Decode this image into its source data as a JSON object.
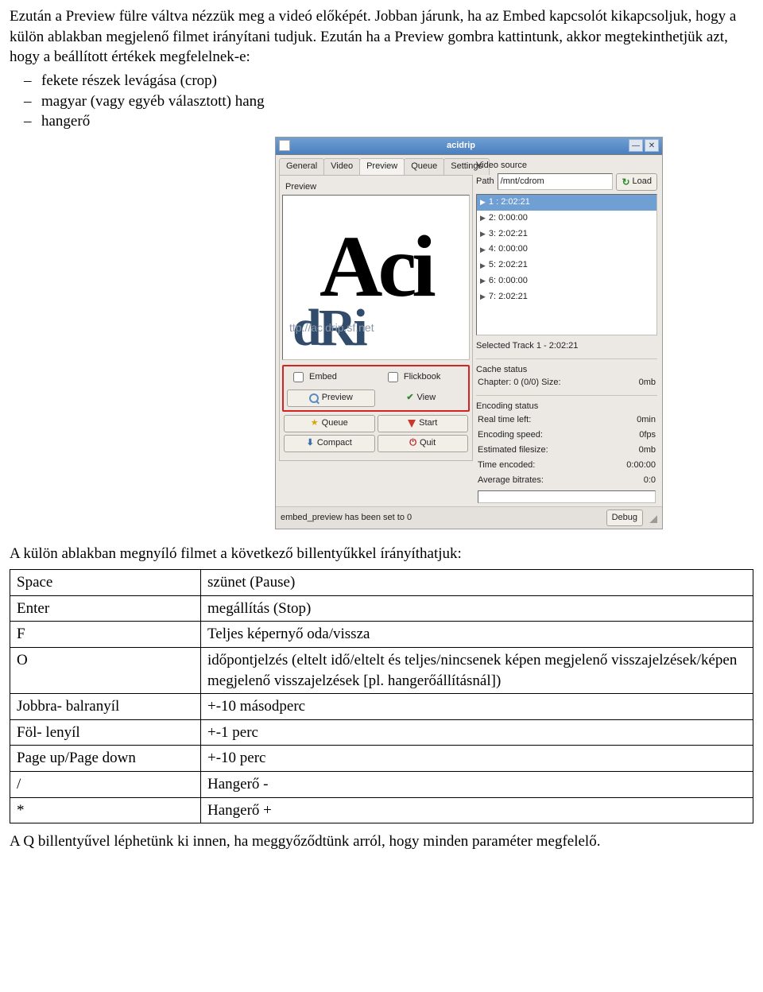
{
  "para1": "Ezután a Preview fülre váltva nézzük meg a videó előképét. Jobban járunk, ha az Embed kapcsolót kikapcsoljuk, hogy a külön ablakban megjelenő filmet irányítani tudjuk. Ezután ha a Preview gombra kattintunk, akkor megtekinthetjük azt, hogy a beállított értékek megfelelnek-e:",
  "bullets": {
    "b1": "fekete részek levágása (crop)",
    "b2": "magyar (vagy egyéb választott) hang",
    "b3": "hangerő"
  },
  "para2": "A külön ablakban megnyíló filmet a következő billentyűkkel írányíthatjuk:",
  "para3": "A Q billentyűvel léphetünk ki innen, ha meggyőződtünk arról, hogy minden paraméter megfelelő.",
  "keys": {
    "k1": "Space",
    "v1": "szünet (Pause)",
    "k2": "Enter",
    "v2": "megállítás (Stop)",
    "k3": "F",
    "v3": "Teljes képernyő oda/vissza",
    "k4": "O",
    "v4": "időpontjelzés (eltelt idő/eltelt és teljes/nincsenek képen megjelenő visszajelzések/képen megjelenő visszajelzések [pl. hangerőállításnál])",
    "k5": "Jobbra- balranyíl",
    "v5": "+-10 másodperc",
    "k6": "Föl- lenyíl",
    "v6": "+-1 perc",
    "k7": "Page up/Page down",
    "v7": "+-10 perc",
    "k8": "/",
    "v8": "Hangerő -",
    "k9": "*",
    "v9": "Hangerő +"
  },
  "win": {
    "title": "acidrip",
    "tabs": {
      "general": "General",
      "video": "Video",
      "preview": "Preview",
      "queue": "Queue",
      "settings": "Settings"
    },
    "preview_label": "Preview",
    "logo_big": "Aci",
    "logo_drip": "dRi",
    "logo_url": "ttp://acidrip.sf.net",
    "embed": "Embed",
    "flickbook": "Flickbook",
    "btn_preview": "Preview",
    "btn_view": "View",
    "btn_queue": "Queue",
    "btn_start": "Start",
    "btn_compact": "Compact",
    "btn_quit": "Quit",
    "src_label": "Video source",
    "path_label": "Path",
    "path_value": "/mnt/cdrom",
    "load": "Load",
    "tracks": {
      "t1": "1 : 2:02:21",
      "t2": "2: 0:00:00",
      "t3": "3: 2:02:21",
      "t4": "4: 0:00:00",
      "t5": "5: 2:02:21",
      "t6": "6: 0:00:00",
      "t7": "7: 2:02:21"
    },
    "selected": "Selected Track 1 - 2:02:21",
    "cache_hdr": "Cache status",
    "chapter_l": "Chapter:  0 (0/0)   Size:",
    "chapter_v": "0mb",
    "enc_hdr": "Encoding status",
    "rt_l": "Real time left:",
    "rt_v": "0min",
    "es_l": "Encoding speed:",
    "es_v": "0fps",
    "ef_l": "Estimated filesize:",
    "ef_v": "0mb",
    "te_l": "Time encoded:",
    "te_v": "0:00:00",
    "ab_l": "Average bitrates:",
    "ab_v": "0:0",
    "status": "embed_preview has been set to 0",
    "debug": "Debug"
  }
}
